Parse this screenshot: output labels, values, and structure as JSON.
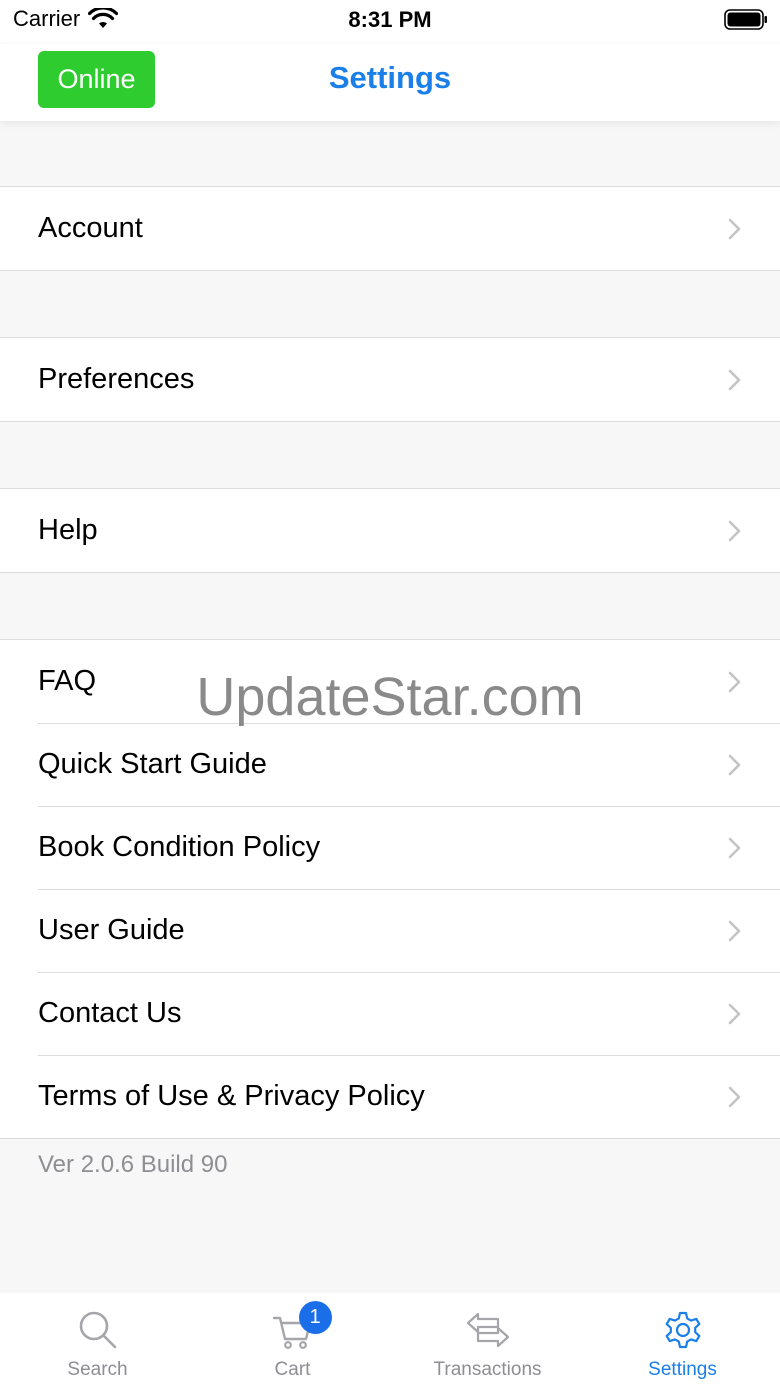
{
  "status_bar": {
    "carrier": "Carrier",
    "time": "8:31 PM"
  },
  "nav": {
    "online_label": "Online",
    "title": "Settings"
  },
  "groups": [
    {
      "items": [
        {
          "label": "Account"
        }
      ]
    },
    {
      "items": [
        {
          "label": "Preferences"
        }
      ]
    },
    {
      "items": [
        {
          "label": "Help"
        }
      ]
    },
    {
      "items": [
        {
          "label": "FAQ"
        },
        {
          "label": "Quick Start Guide"
        },
        {
          "label": "Book Condition Policy"
        },
        {
          "label": "User Guide"
        },
        {
          "label": "Contact Us"
        },
        {
          "label": "Terms of Use & Privacy Policy"
        }
      ]
    }
  ],
  "watermark": "UpdateStar.com",
  "version": "Ver 2.0.6 Build 90",
  "tabs": [
    {
      "label": "Search",
      "icon": "search-icon"
    },
    {
      "label": "Cart",
      "icon": "cart-icon",
      "badge": "1"
    },
    {
      "label": "Transactions",
      "icon": "transactions-icon"
    },
    {
      "label": "Settings",
      "icon": "gear-icon",
      "active": true
    }
  ],
  "colors": {
    "accent": "#1a7fe8",
    "online": "#2fcc2f",
    "badge": "#1a6fe8"
  }
}
